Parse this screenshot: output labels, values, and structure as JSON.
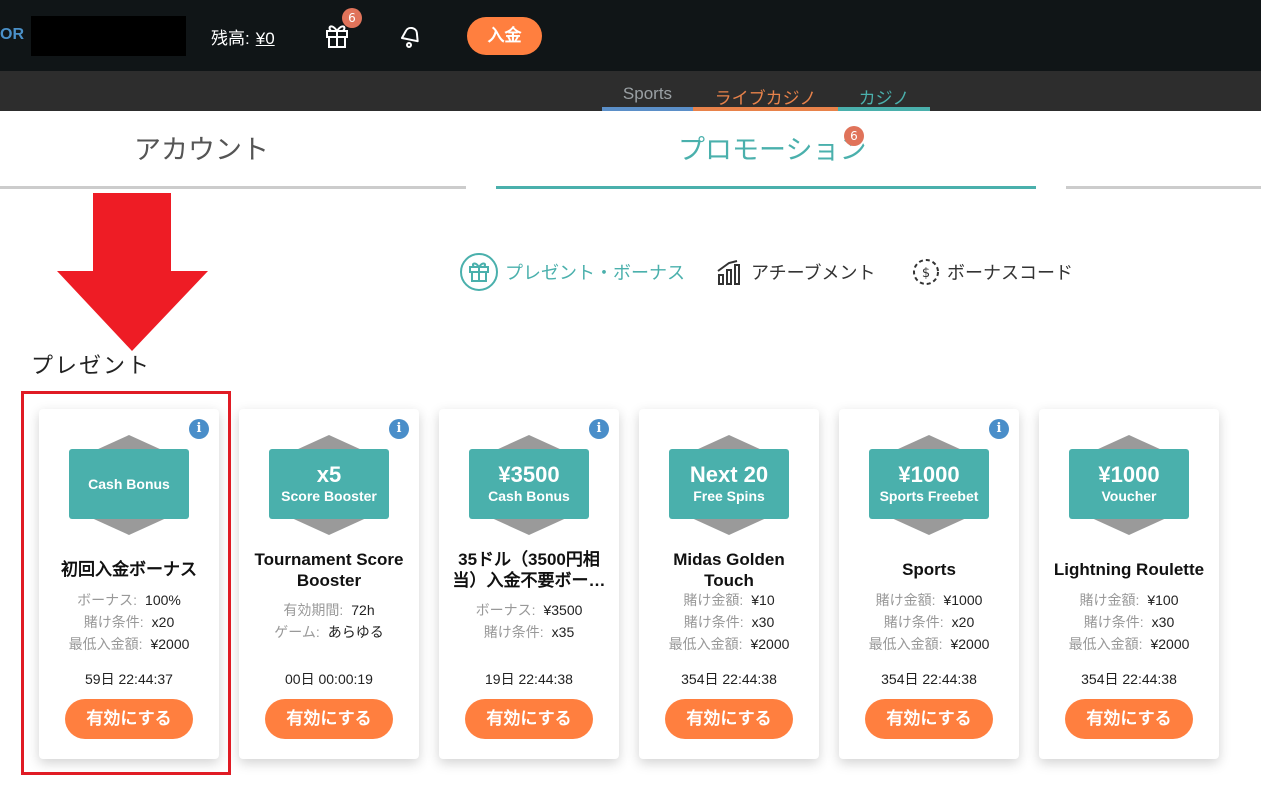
{
  "header": {
    "logo_text": "OR",
    "balance_label": "残高:",
    "balance_value": "¥0",
    "gift_count": "6",
    "deposit_label": "入金"
  },
  "nav": {
    "tabs": [
      {
        "label": "Sports",
        "color": "#5b8fc8"
      },
      {
        "label": "ライブカジノ",
        "color": "#e8824a"
      },
      {
        "label": "カジノ",
        "color": "#4ab0ac"
      }
    ]
  },
  "account_tabs": {
    "account_label": "アカウント",
    "promotion_label": "プロモーション",
    "promotion_count": "6"
  },
  "filters": {
    "present_bonus": "プレゼント・ボーナス",
    "achievement": "アチーブメント",
    "bonus_code": "ボーナスコード"
  },
  "section": {
    "title": "プレゼント"
  },
  "cards": [
    {
      "badge_big": "",
      "badge_small": "Cash Bonus",
      "title": "初回入金ボーナス",
      "details": [
        {
          "k": "ボーナス:",
          "v": "100%"
        },
        {
          "k": "賭け条件:",
          "v": "x20"
        },
        {
          "k": "最低入金額:",
          "v": "¥2000"
        }
      ],
      "timer": "59日  22:44:37",
      "button": "有効にする"
    },
    {
      "badge_big": "x5",
      "badge_small": "Score Booster",
      "title": "Tournament Score Booster",
      "details": [
        {
          "k": "有効期間:",
          "v": "72h"
        },
        {
          "k": "ゲーム:",
          "v": "あらゆる"
        }
      ],
      "timer": "00日  00:00:19",
      "button": "有効にする"
    },
    {
      "badge_big": "¥3500",
      "badge_small": "Cash Bonus",
      "title": "35ドル（3500円相当）入金不要ボー…",
      "details": [
        {
          "k": "ボーナス:",
          "v": "¥3500"
        },
        {
          "k": "賭け条件:",
          "v": "x35"
        }
      ],
      "timer": "19日  22:44:38",
      "button": "有効にする"
    },
    {
      "badge_big": "Next 20",
      "badge_small": "Free Spins",
      "title": "Midas Golden Touch",
      "details": [
        {
          "k": "賭け金額:",
          "v": "¥10"
        },
        {
          "k": "賭け条件:",
          "v": "x30"
        },
        {
          "k": "最低入金額:",
          "v": "¥2000"
        }
      ],
      "timer": "354日  22:44:38",
      "button": "有効にする"
    },
    {
      "badge_big": "¥1000",
      "badge_small": "Sports Freebet",
      "title": "Sports",
      "details": [
        {
          "k": "賭け金額:",
          "v": "¥1000"
        },
        {
          "k": "賭け条件:",
          "v": "x20"
        },
        {
          "k": "最低入金額:",
          "v": "¥2000"
        }
      ],
      "timer": "354日  22:44:38",
      "button": "有効にする"
    },
    {
      "badge_big": "¥1000",
      "badge_small": "Voucher",
      "title": "Lightning Roulette",
      "details": [
        {
          "k": "賭け金額:",
          "v": "¥100"
        },
        {
          "k": "賭け条件:",
          "v": "x30"
        },
        {
          "k": "最低入金額:",
          "v": "¥2000"
        }
      ],
      "timer": "354日  22:44:38",
      "button": "有効にする"
    }
  ]
}
